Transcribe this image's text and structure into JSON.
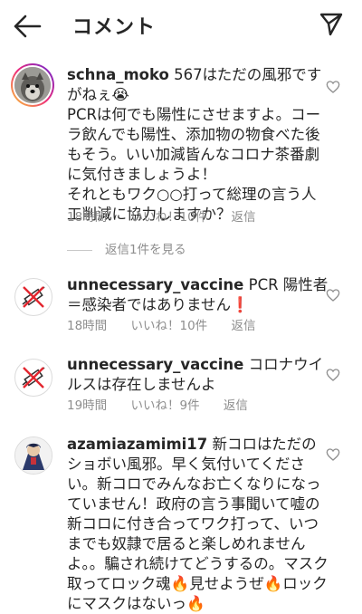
{
  "header": {
    "title": "コメント"
  },
  "comments": [
    {
      "username": "schna_moko",
      "text": " 567はただの風邪ですがねぇ😭\nPCRは何でも陽性にさせますよ。コーラ飲んでも陽性、添加物の物食べた後もそう。いい加減皆んなコロナ茶番劇に気付きましょうよ！\nそれともワク○○打って総理の言う人工削減に協力しますか？",
      "time": "18時間",
      "likes": "いいね！10件",
      "reply": "返信"
    },
    {
      "username": "unnecessary_vaccine",
      "text": " PCR 陽性者＝感染者ではありません❗",
      "time": "18時間",
      "likes": "いいね！10件",
      "reply": "返信"
    },
    {
      "username": "unnecessary_vaccine",
      "text": " コロナウイルスは存在しませんよ",
      "time": "19時間",
      "likes": "いいね！9件",
      "reply": "返信"
    },
    {
      "username": "azamiazamimi17",
      "text": " 新コロはただのショボい風邪。早く気付いてください。新コロでみんなお亡くなりになっていません！政府の言う事聞いて嘘の新コロに付き合ってワク打って、いつまでも奴隷で居ると楽しめれませんよ。。騙され続けてどうするの。マスク取ってロック魂🔥見せようぜ🔥ロックにマスクはないっ🔥",
      "time": "",
      "likes": "",
      "reply": ""
    }
  ],
  "view_replies": "返信1件を見る",
  "icons": {
    "back": "back-arrow-icon",
    "send": "send-icon",
    "like": "heart-icon",
    "no_vaccine_avatar": "no-syringe-icon"
  }
}
